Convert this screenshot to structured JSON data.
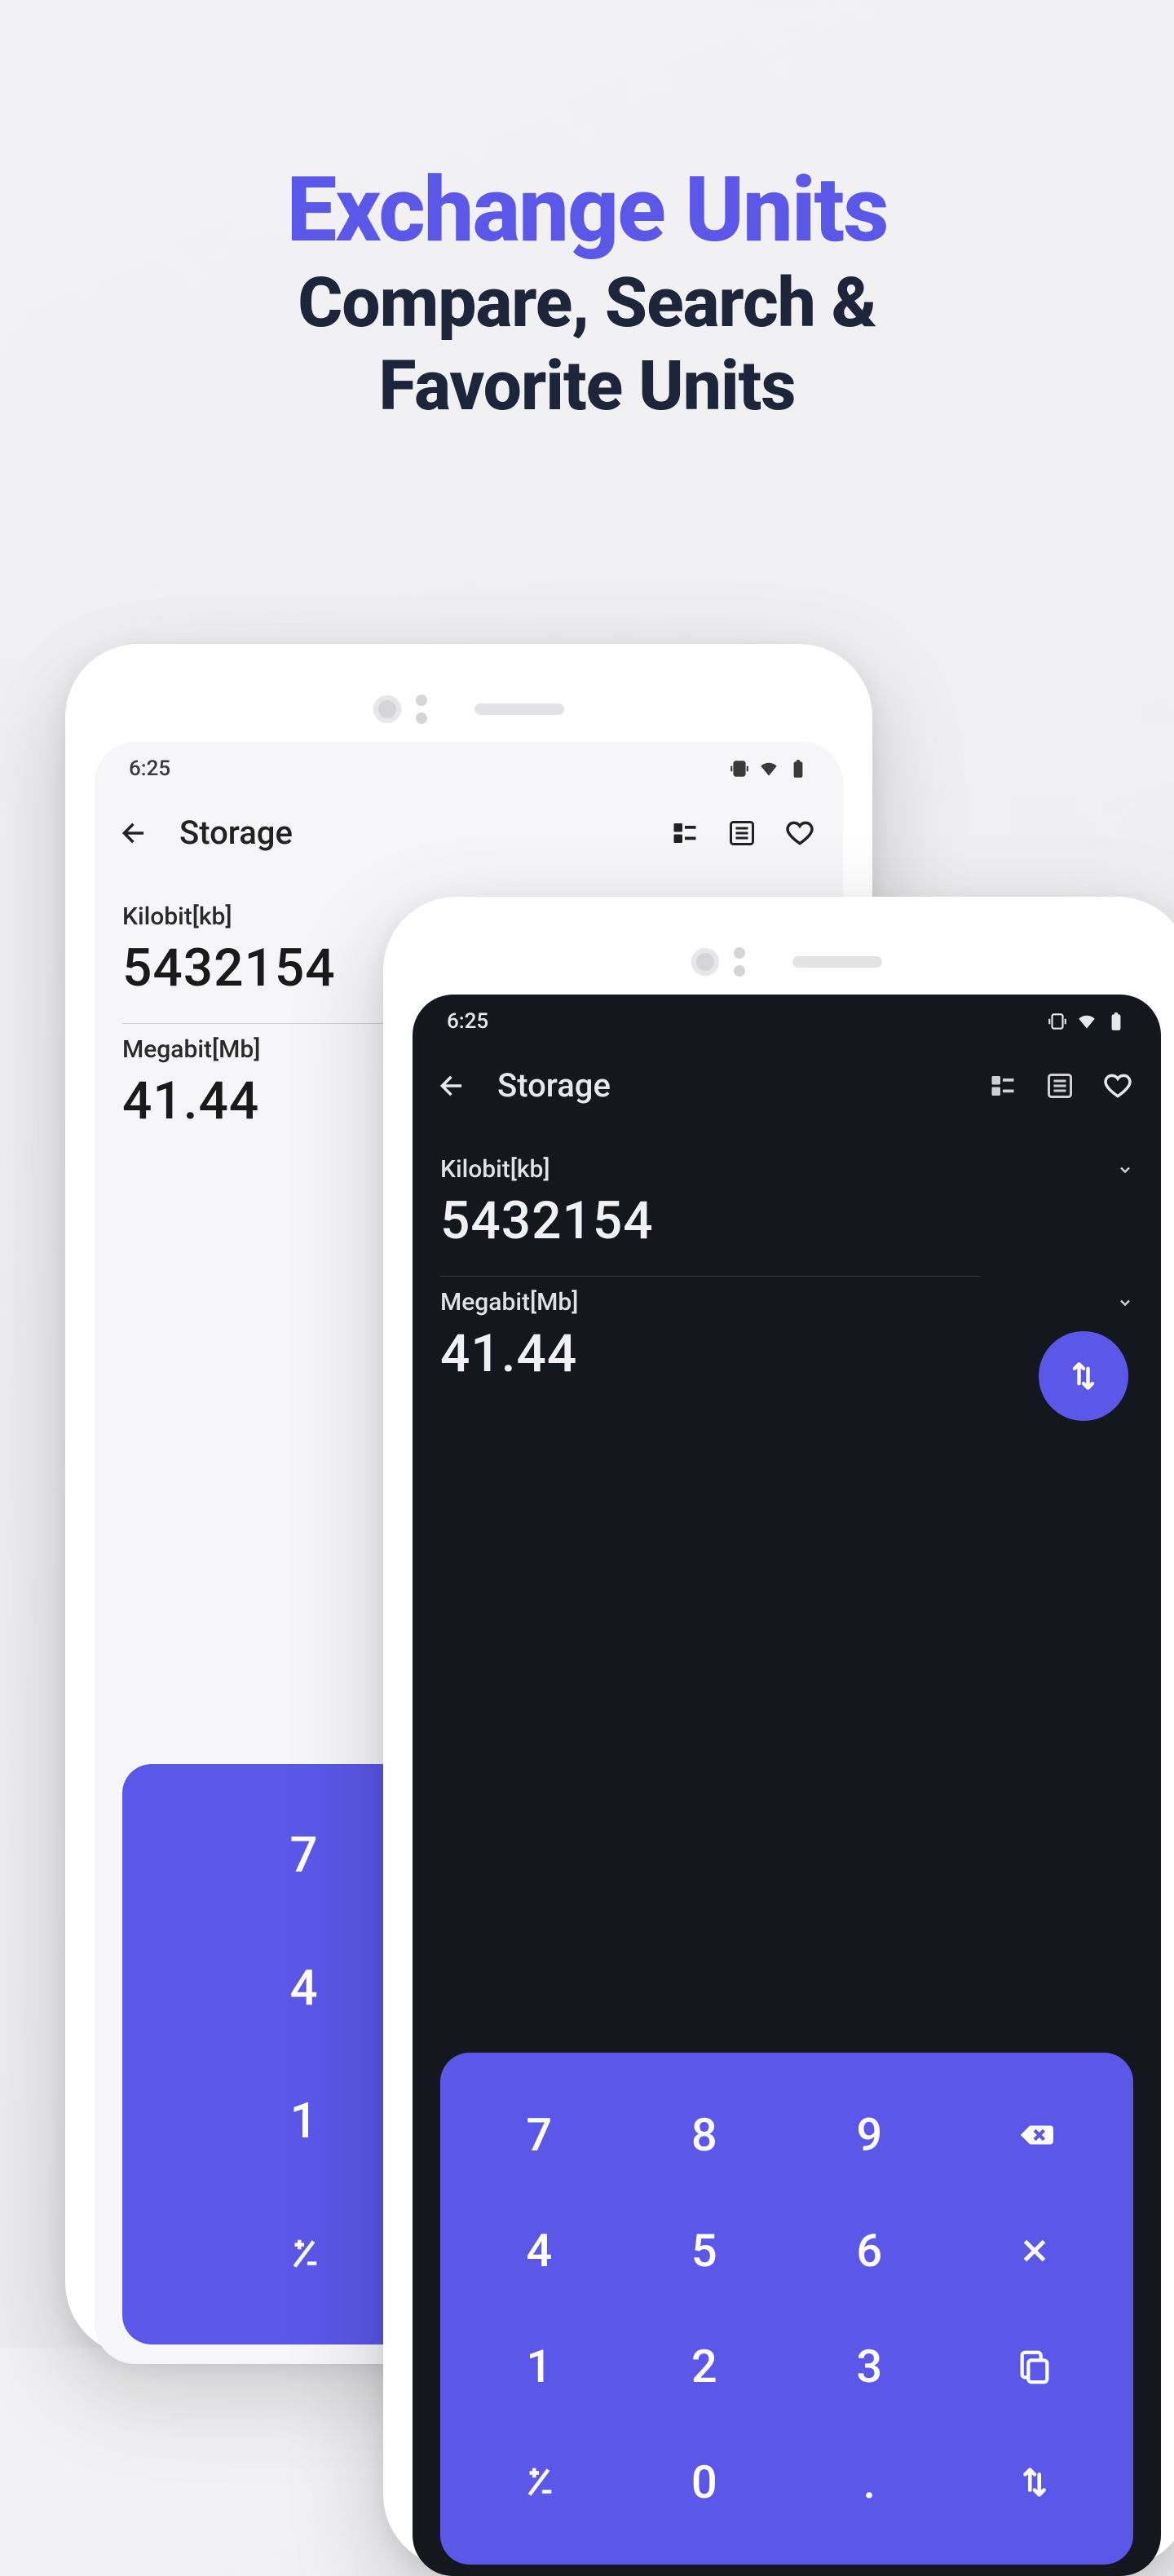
{
  "headline": {
    "title": "Exchange Units",
    "subtitle_line1": "Compare, Search &",
    "subtitle_line2": "Favorite Units"
  },
  "status": {
    "time": "6:25"
  },
  "app": {
    "screen_title": "Storage",
    "from_unit_label": "Kilobit[kb]",
    "from_value": "5432154",
    "to_unit_label": "Megabit[Mb]",
    "to_value": "41.44"
  },
  "keypad": {
    "r1": [
      "7",
      "8",
      "9"
    ],
    "r2": [
      "4",
      "5",
      "6"
    ],
    "r3": [
      "1",
      "2",
      "3"
    ],
    "r4_dot": ".",
    "r4_zero": "0"
  }
}
